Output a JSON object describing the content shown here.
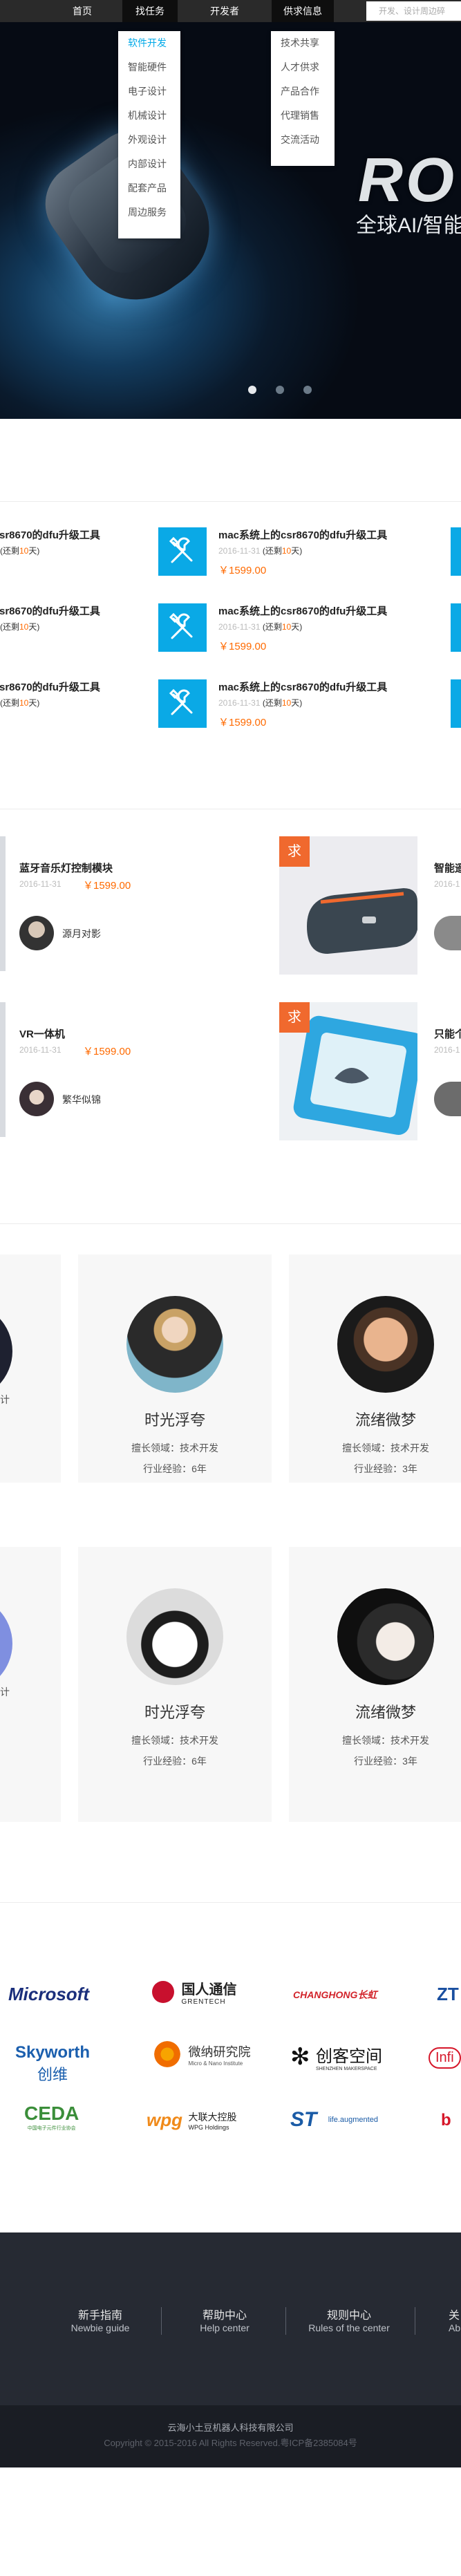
{
  "nav": {
    "items": [
      "首页",
      "找任务",
      "开发者",
      "供求信息"
    ],
    "search_placeholder": "开发、设计周边碎"
  },
  "task_menu": [
    "软件开发",
    "智能硬件",
    "电子设计",
    "机械设计",
    "外观设计",
    "内部设计",
    "配套产品",
    "周边服务"
  ],
  "supply_menu": [
    "技术共享",
    "人才供求",
    "产品合作",
    "代理销售",
    "交流活动"
  ],
  "hero": {
    "title": "RO",
    "subtitle": "全球AI/智能"
  },
  "tasks": [
    {
      "title_partial": "sr8670的dfu升级工具",
      "remaining": "(还剩",
      "num": "10",
      "unit": "天)",
      "title": "mac系统上的csr8670的dfu升级工具",
      "date": "2016-11-31",
      "price": "￥1599.00"
    },
    {
      "title_partial": "sr8670的dfu升级工具",
      "remaining": "(还剩",
      "num": "10",
      "unit": "天)",
      "title": "mac系统上的csr8670的dfu升级工具",
      "date": "2016-11-31",
      "price": "￥1599.00"
    },
    {
      "title_partial": "sr8670的dfu升级工具",
      "remaining": "(还剩",
      "num": "10",
      "unit": "天)",
      "title": "mac系统上的csr8670的dfu升级工具",
      "date": "2016-11-31",
      "price": "￥1599.00"
    }
  ],
  "products": [
    {
      "title": "蓝牙音乐灯控制模块",
      "date": "2016-11-31",
      "price": "￥1599.00",
      "user": "源月对影",
      "badge": "求",
      "right_title": "智能遥",
      "right_date": "2016-1"
    },
    {
      "title": "VR一体机",
      "date": "2016-11-31",
      "price": "￥1599.00",
      "user": "繁华似锦",
      "badge": "求",
      "right_title": "只能个",
      "right_date": "2016-1"
    }
  ],
  "designers": [
    {
      "left_line": "计",
      "name": "时光浮夸",
      "field": "擅长领域：技术开发",
      "exp": "行业经验：6年",
      "name2": "流绪微梦",
      "field2": "擅长领域：技术开发",
      "exp2": "行业经验：3年"
    },
    {
      "left_line": "计",
      "name": "时光浮夸",
      "field": "擅长领域：技术开发",
      "exp": "行业经验：6年",
      "name2": "流绪微梦",
      "field2": "擅长领域：技术开发",
      "exp2": "行业经验：3年"
    }
  ],
  "partners": {
    "row1": [
      "Microsoft",
      "国人通信",
      "GRENTECH",
      "CHANGHONG长虹",
      "ZT"
    ],
    "row2": [
      "Skyworth",
      "创维",
      "微纳研究院",
      "Micro & Nano Institute",
      "创客空间",
      "SHENZHEN MAKERSPACE",
      "Infi"
    ],
    "row3": [
      "CEDA",
      "中国电子元件行业协会",
      "wpg",
      "大联大控股",
      "WPG Holdings",
      "ST",
      "life.augmented",
      "b"
    ]
  },
  "footer": {
    "links": [
      {
        "cn": "新手指南",
        "en": "Newbie guide"
      },
      {
        "cn": "帮助中心",
        "en": "Help center"
      },
      {
        "cn": "规则中心",
        "en": "Rules of the center"
      },
      {
        "cn": "关",
        "en": "Ab"
      }
    ],
    "company": "云海小土豆机器人科技有限公司",
    "copyright": "Copyright © 2015-2016  All Rights Reserved.粤ICP备2385084号"
  }
}
